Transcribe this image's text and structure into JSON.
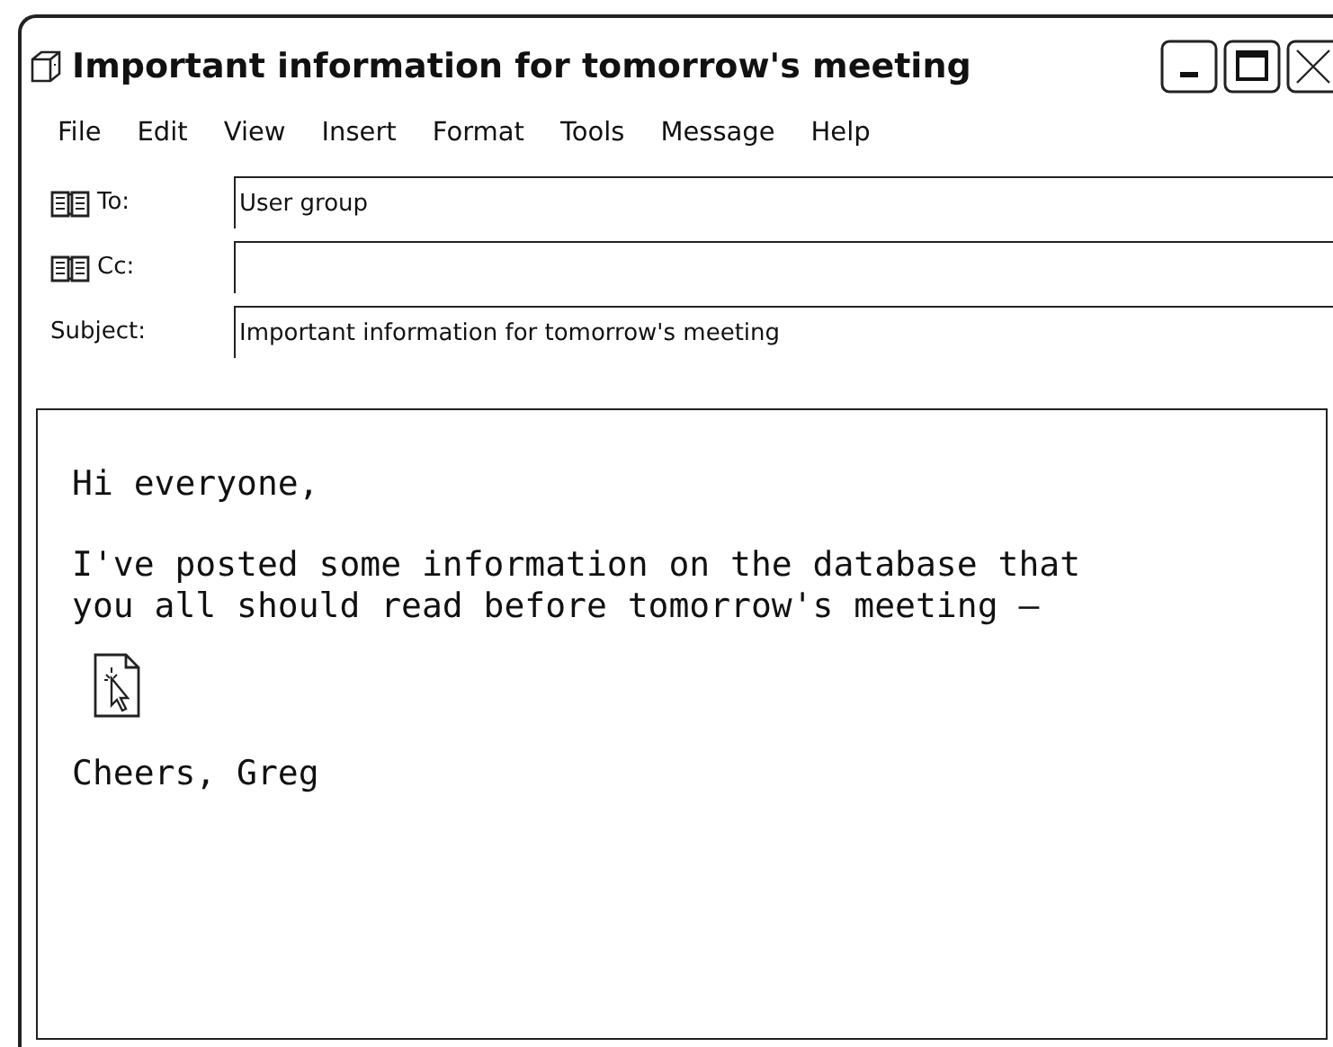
{
  "window": {
    "title": "Important information for tomorrow's meeting"
  },
  "menu": [
    "File",
    "Edit",
    "View",
    "Insert",
    "Format",
    "Tools",
    "Message",
    "Help"
  ],
  "fields": [
    {
      "label": "To:",
      "address_book": true,
      "value": "User group"
    },
    {
      "label": "Cc:",
      "address_book": true
    },
    {
      "label": "Subject:",
      "address_book": false,
      "value": "Important information for tomorrow's meeting"
    }
  ],
  "body": {
    "greeting": "Hi everyone,",
    "paragraph_lines": [
      "I've posted some information on the database that",
      "you all should read before tomorrow's meeting –"
    ],
    "signature": "Cheers, Greg"
  }
}
